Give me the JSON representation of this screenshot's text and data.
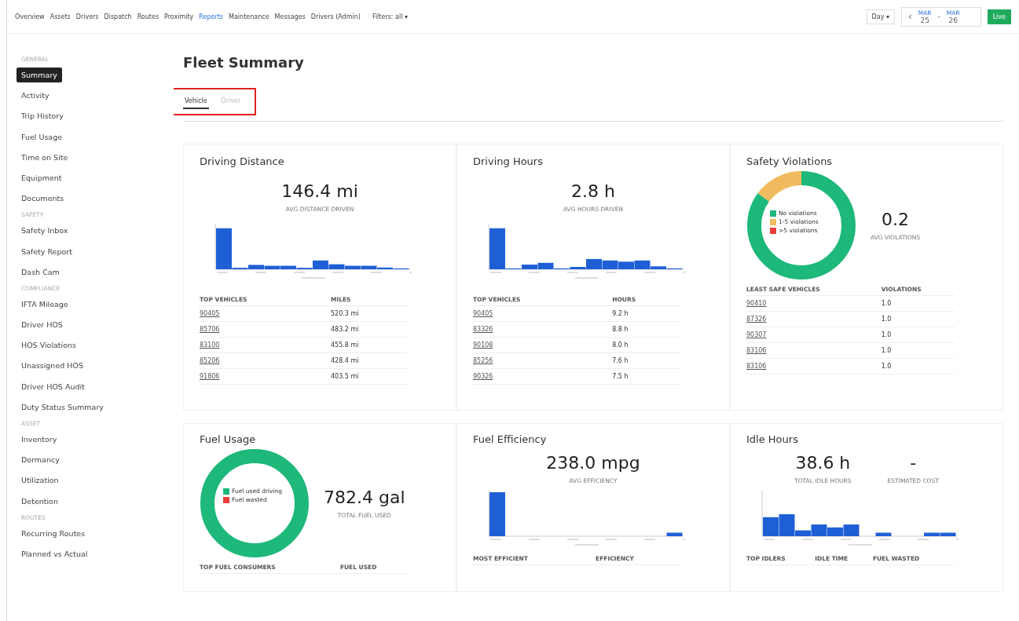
{
  "nav": {
    "items": [
      {
        "label": "Overview",
        "selected": false
      },
      {
        "label": "Assets",
        "selected": false
      },
      {
        "label": "Drivers",
        "selected": false
      },
      {
        "label": "Dispatch",
        "selected": false
      },
      {
        "label": "Routes",
        "selected": false
      },
      {
        "label": "Proximity",
        "selected": false
      },
      {
        "label": "Reports",
        "selected": true
      },
      {
        "label": "Maintenance",
        "selected": false
      },
      {
        "label": "Messages",
        "selected": false
      },
      {
        "label": "Drivers (Admin)",
        "selected": false
      }
    ],
    "filter": "Filters: all ▾",
    "period": "Day ▾",
    "prev": "‹",
    "start": {
      "month": "MAR",
      "day": "25"
    },
    "separator": "-",
    "end": {
      "month": "MAR",
      "day": "26"
    },
    "live": "Live"
  },
  "sidebar": [
    {
      "heading": "GENERAL",
      "items": [
        {
          "label": "Summary",
          "selected": true
        },
        {
          "label": "Activity",
          "selected": false
        },
        {
          "label": "Trip History",
          "selected": false
        },
        {
          "label": "Fuel Usage",
          "selected": false
        },
        {
          "label": "Time on Site",
          "selected": false
        },
        {
          "label": "Equipment",
          "selected": false
        },
        {
          "label": "Documents",
          "selected": false
        }
      ]
    },
    {
      "heading": "SAFETY",
      "items": [
        {
          "label": "Safety Inbox",
          "selected": false
        },
        {
          "label": "Safety Report",
          "selected": false
        },
        {
          "label": "Dash Cam",
          "selected": false
        }
      ]
    },
    {
      "heading": "COMPLIANCE",
      "items": [
        {
          "label": "IFTA Mileage",
          "selected": false
        },
        {
          "label": "Driver HOS",
          "selected": false
        },
        {
          "label": "HOS Violations",
          "selected": false
        },
        {
          "label": "Unassigned HOS",
          "selected": false
        },
        {
          "label": "Driver HOS Audit",
          "selected": false
        },
        {
          "label": "Duty Status Summary",
          "selected": false
        }
      ]
    },
    {
      "heading": "ASSET",
      "items": [
        {
          "label": "Inventory",
          "selected": false
        },
        {
          "label": "Dormancy",
          "selected": false
        },
        {
          "label": "Utilization",
          "selected": false
        },
        {
          "label": "Detention",
          "selected": false
        }
      ]
    },
    {
      "heading": "ROUTES",
      "items": [
        {
          "label": "Recurring Routes",
          "selected": false
        },
        {
          "label": "Planned vs Actual",
          "selected": false
        }
      ]
    }
  ],
  "title": "Fleet Summary",
  "tabs": [
    {
      "label": "Vehicle",
      "selected": true
    },
    {
      "label": "Driver",
      "selected": false
    }
  ],
  "cards": [
    {
      "title": "Driving Distance",
      "kind": "histogram",
      "stats": [
        {
          "value": "146.4 mi",
          "caption": "AVG DISTANCE DRIVEN"
        }
      ],
      "columns": [
        "TOP VEHICLES",
        "MILES"
      ],
      "rows": [
        [
          "90405",
          "520.3 mi"
        ],
        [
          "85706",
          "483.2 mi"
        ],
        [
          "83100",
          "455.8 mi"
        ],
        [
          "85206",
          "428.4 mi"
        ],
        [
          "91806",
          "403.5 mi"
        ]
      ]
    },
    {
      "title": "Driving Hours",
      "kind": "histogram",
      "stats": [
        {
          "value": "2.8 h",
          "caption": "AVG HOURS DRIVEN"
        }
      ],
      "columns": [
        "TOP VEHICLES",
        "HOURS"
      ],
      "rows": [
        [
          "90405",
          "9.2 h"
        ],
        [
          "83326",
          "8.8 h"
        ],
        [
          "90108",
          "8.0 h"
        ],
        [
          "85256",
          "7.6 h"
        ],
        [
          "90326",
          "7.5 h"
        ]
      ]
    },
    {
      "title": "Safety Violations",
      "kind": "donut",
      "legend": [
        {
          "label": "No violations",
          "color": "#1db87a"
        },
        {
          "label": "1-5 violations",
          "color": "#f0bb5e"
        },
        {
          "label": ">5 violations",
          "color": "#ea3e3a"
        }
      ],
      "stats": [
        {
          "value": "0.2",
          "caption": "AVG VIOLATIONS"
        }
      ],
      "columns": [
        "LEAST SAFE VEHICLES",
        "VIOLATIONS"
      ],
      "rows": [
        [
          "90410",
          "1.0"
        ],
        [
          "87326",
          "1.0"
        ],
        [
          "90307",
          "1.0"
        ],
        [
          "83106",
          "1.0"
        ],
        [
          "83106",
          "1.0"
        ]
      ]
    },
    {
      "title": "Fuel Usage",
      "kind": "donut",
      "legend": [
        {
          "label": "Fuel used driving",
          "color": "#1db87a"
        },
        {
          "label": "Fuel wasted",
          "color": "#ea3e3a"
        }
      ],
      "stats": [
        {
          "value": "782.4 gal",
          "caption": "TOTAL FUEL USED"
        }
      ],
      "columns": [
        "TOP FUEL CONSUMERS",
        "FUEL USED"
      ]
    },
    {
      "title": "Fuel Efficiency",
      "kind": "histogram",
      "stats": [
        {
          "value": "238.0 mpg",
          "caption": "AVG EFFICIENCY"
        }
      ],
      "columns": [
        "MOST EFFICIENT",
        "EFFICIENCY"
      ]
    },
    {
      "title": "Idle Hours",
      "kind": "histogram",
      "stats": [
        {
          "value": "38.6 h",
          "caption": "TOTAL IDLE HOURS"
        },
        {
          "value": "-",
          "caption": "ESTIMATED COST"
        }
      ],
      "columns": [
        "TOP IDLERS",
        "IDLE TIME",
        "FUEL WASTED"
      ]
    }
  ]
}
